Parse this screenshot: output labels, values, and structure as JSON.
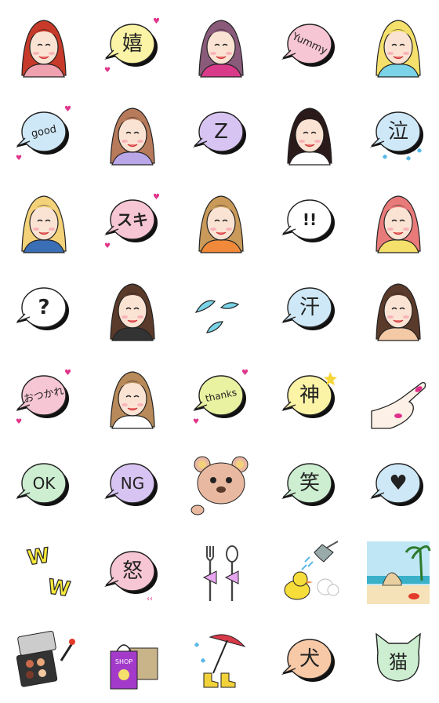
{
  "colors": {
    "pink": "#f7c6d4",
    "lilac": "#d8c4f2",
    "blue": "#cfe8f7",
    "mint": "#cdeed1",
    "yellow": "#fbf3a5",
    "peach": "#f8c9a6",
    "red_hair": "#c73a2a",
    "magenta": "#e02f8a",
    "cyan": "#7ad3e6"
  },
  "grid": {
    "rows": [
      [
        {
          "name": "woman-red-hair-laughing",
          "kind": "face",
          "hair": "#c73a2a",
          "clothes": "#f0a1b0"
        },
        {
          "name": "bubble-嬉",
          "kind": "bubble",
          "text": "嬉",
          "fill": "#fbf3a5"
        },
        {
          "name": "woman-purple-hair-eating",
          "kind": "face",
          "hair": "#8a5a7a",
          "clothes": "#d93a8a"
        },
        {
          "name": "bubble-yummy",
          "kind": "bubble",
          "text": "Yummy",
          "fill": "#f7c6d4"
        },
        {
          "name": "woman-blonde-surprised",
          "kind": "face",
          "hair": "#f4e06a",
          "clothes": "#7ad3e6"
        }
      ],
      [
        {
          "name": "bubble-good",
          "kind": "bubble",
          "text": "good",
          "fill": "#cfe8f7"
        },
        {
          "name": "woman-sleeping-pillow",
          "kind": "face",
          "hair": "#b77a5a",
          "clothes": "#b9a7e8"
        },
        {
          "name": "bubble-z",
          "kind": "bubble",
          "text": "Z",
          "fill": "#d8c4f2"
        },
        {
          "name": "woman-dark-hair-sad",
          "kind": "face",
          "hair": "#2b1a1a",
          "clothes": "#ffffff"
        },
        {
          "name": "bubble-泣",
          "kind": "bubble",
          "text": "泣",
          "fill": "#cfe8f7"
        }
      ],
      [
        {
          "name": "woman-blonde-wink",
          "kind": "face",
          "hair": "#f3d27a",
          "clothes": "#3b6fb5"
        },
        {
          "name": "bubble-スキ",
          "kind": "bubble",
          "text": "スキ",
          "fill": "#f7c6d4"
        },
        {
          "name": "woman-brown-hair-shocked",
          "kind": "face",
          "hair": "#c99a5a",
          "clothes": "#f08a3a"
        },
        {
          "name": "bubble-exclamation",
          "kind": "bubble",
          "text": "!!",
          "fill": "#ffffff"
        },
        {
          "name": "woman-pink-hair-crying",
          "kind": "face",
          "hair": "#e97a7a",
          "clothes": "#f4e06a"
        }
      ],
      [
        {
          "name": "bubble-question",
          "kind": "bubble",
          "text": "?",
          "fill": "#ffffff"
        },
        {
          "name": "woman-brown-hair-sweat",
          "kind": "face",
          "hair": "#5a3a2a",
          "clothes": "#333333"
        },
        {
          "name": "sweat-drops",
          "kind": "drops",
          "text": ""
        },
        {
          "name": "bubble-汗",
          "kind": "bubble",
          "text": "汗",
          "fill": "#cfe8f7"
        },
        {
          "name": "woman-brown-hair-worried",
          "kind": "face",
          "hair": "#5a3a2a",
          "clothes": "#f4c9a6"
        }
      ],
      [
        {
          "name": "bubble-おつかれ",
          "kind": "bubble",
          "text": "おつかれ",
          "fill": "#f7c6d4"
        },
        {
          "name": "woman-side-profile-earring",
          "kind": "face",
          "hair": "#b88a5a",
          "clothes": "#ffffff"
        },
        {
          "name": "bubble-thanks",
          "kind": "bubble",
          "text": "thanks",
          "fill": "#e9f2a0"
        },
        {
          "name": "bubble-神",
          "kind": "bubble",
          "text": "神",
          "fill": "#fbf3a5"
        },
        {
          "name": "hand-pointing",
          "kind": "hand",
          "text": ""
        }
      ],
      [
        {
          "name": "bubble-ok",
          "kind": "bubble",
          "text": "OK",
          "fill": "#cdeed1"
        },
        {
          "name": "bubble-ng",
          "kind": "bubble",
          "text": "NG",
          "fill": "#d8c4f2"
        },
        {
          "name": "teddy-bear-face",
          "kind": "bear",
          "text": ""
        },
        {
          "name": "bubble-笑",
          "kind": "bubble",
          "text": "笑",
          "fill": "#cdeed1"
        },
        {
          "name": "bubble-heart",
          "kind": "bubble",
          "text": "♥",
          "fill": "#cfe8f7"
        }
      ],
      [
        {
          "name": "text-ww",
          "kind": "ww",
          "text": "W W"
        },
        {
          "name": "bubble-怒",
          "kind": "bubble",
          "text": "怒",
          "fill": "#f7c6d4"
        },
        {
          "name": "fork-and-spoon",
          "kind": "cutlery",
          "text": ""
        },
        {
          "name": "shower-and-duck",
          "kind": "shower",
          "text": ""
        },
        {
          "name": "beach-scene",
          "kind": "beach",
          "text": ""
        }
      ],
      [
        {
          "name": "makeup-palette",
          "kind": "palette",
          "text": ""
        },
        {
          "name": "shopping-bags",
          "kind": "shop",
          "text": "SHOP"
        },
        {
          "name": "umbrella-and-boots",
          "kind": "umbrella",
          "text": ""
        },
        {
          "name": "bubble-犬",
          "kind": "bubble",
          "text": "犬",
          "fill": "#f8c9a6"
        },
        {
          "name": "bubble-猫",
          "kind": "catbubble",
          "text": "猫",
          "fill": "#cdeed1"
        }
      ]
    ]
  }
}
